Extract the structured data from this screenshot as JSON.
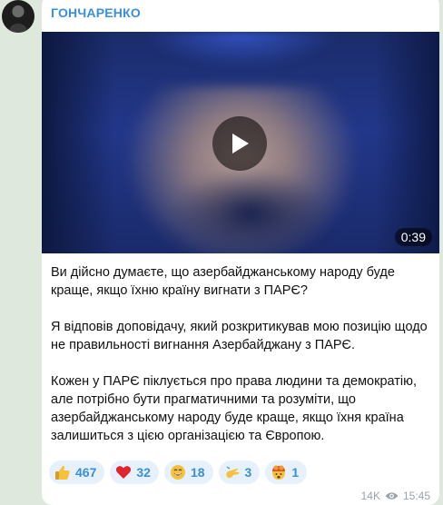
{
  "channel": {
    "author": "ГОНЧАРЕНКО"
  },
  "video": {
    "duration": "0:39"
  },
  "message": {
    "paragraphs": [
      "Ви дійсно думаєте, що азербайджанському народу буде краще, якщо їхню країну вигнати з ПАРЄ?",
      "Я відповів доповідачу, який розкритикував мою позицію щодо не правильності вигнання Азербайджану з ПАРЄ.",
      "Кожен у ПАРЄ піклується про права людини та демократію, але потрібно бути прагматичними та розуміти, що азербайджанському народу буде краще, якщо їхня країна залишиться з цією організацією та Європою."
    ]
  },
  "reactions": [
    {
      "icon": "thumbs-up-icon",
      "count": "467"
    },
    {
      "icon": "red-heart-icon",
      "count": "32"
    },
    {
      "icon": "grinning-face-icon",
      "count": "18"
    },
    {
      "icon": "pinching-hand-icon",
      "count": "3"
    },
    {
      "icon": "exploding-head-icon",
      "count": "1"
    }
  ],
  "footer": {
    "views": "14K",
    "time": "15:45"
  },
  "colors": {
    "accent": "#3a8fd9",
    "bubble": "#ffffff",
    "background": "#dfe8dc"
  }
}
